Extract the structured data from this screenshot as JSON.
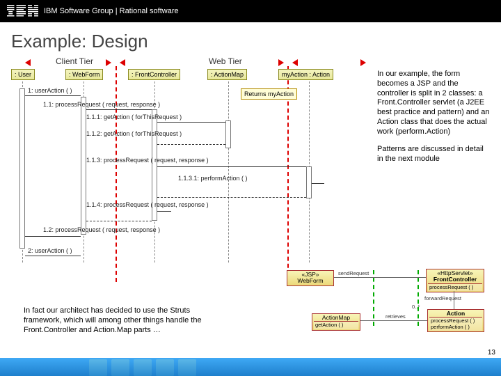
{
  "header": {
    "text": "IBM Software Group | Rational software"
  },
  "title": "Example: Design",
  "tiers": {
    "client": "Client Tier",
    "web": "Web Tier"
  },
  "lifelines": {
    "user": ": User",
    "webform": ": WebForm",
    "front": ": FrontController",
    "actionmap": ": ActionMap",
    "myaction": "myAction : Action"
  },
  "messages": {
    "m1": "1: userAction ( )",
    "m11": "1.1: processRequest ( request, response )",
    "m111": "1.1.1: getAction ( forThisRequest )",
    "m112": "1.1.2: getAction ( forThisRequest )",
    "m113": "1.1.3: processRequest ( request, response )",
    "m1131": "1.1.3.1: performAction ( )",
    "m114": "1.1.4: processRequest ( request, response )",
    "m12": "1.2: processRequest ( request, response )",
    "m2": "2: userAction ( )"
  },
  "note": "Returns myAction",
  "side": {
    "p1": "In our example, the form becomes a JSP and the controller is split in 2 classes: a Front.Controller servlet (a J2EE best practice and pattern) and an Action class that does the actual work (perform.Action)",
    "p2": "Patterns are discussed in detail in the next module"
  },
  "bottom": "In fact our architect has decided to use the Struts framework, which will among other things handle the Front.Controller and Action.Map parts …",
  "class": {
    "webform": {
      "st": "«JSP»",
      "name": "WebForm"
    },
    "front": {
      "st": "«HttpServlet»",
      "name": "FrontController",
      "ops": "processRequest ( )"
    },
    "actionmap": {
      "name": "ActionMap",
      "ops": "getAction ( )"
    },
    "action": {
      "name": "Action",
      "ops1": "processRequest ( )",
      "ops2": "performAction ( )"
    },
    "assoc": {
      "send": "sendRequest",
      "fwd": "forwardRequest",
      "ret": "retrieves",
      "mult": "0..*"
    }
  },
  "page": "13"
}
